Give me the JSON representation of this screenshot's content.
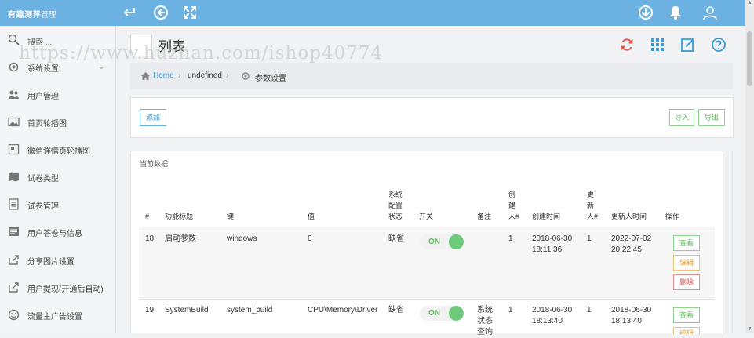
{
  "topbar": {
    "brand": "有趣测评",
    "brand_sub": "管理",
    "icons": [
      "back-icon",
      "circle-left-icon",
      "fullscreen-icon",
      "download-icon",
      "bell-icon",
      "user-icon"
    ]
  },
  "sidebar": {
    "search_placeholder": "搜索 ...",
    "items": [
      {
        "label": "系统设置",
        "icon": "gear-icon",
        "expandable": true
      },
      {
        "label": "用户管理",
        "icon": "users-icon"
      },
      {
        "label": "首页轮播图",
        "icon": "image-icon"
      },
      {
        "label": "微信详情页轮播图",
        "icon": "picture-icon"
      },
      {
        "label": "试卷类型",
        "icon": "map-icon"
      },
      {
        "label": "试卷管理",
        "icon": "file-icon"
      },
      {
        "label": "用户答卷与信息",
        "icon": "newspaper-icon"
      },
      {
        "label": "分享图片设置",
        "icon": "share-icon"
      },
      {
        "label": "用户提现(开通后自动)",
        "icon": "share-out-icon"
      },
      {
        "label": "流量主广告设置",
        "icon": "smile-icon"
      }
    ]
  },
  "watermark": "https://www.huzhan.com/ishop40774",
  "page": {
    "title": "列表",
    "tools": [
      "refresh-icon",
      "grid-icon",
      "edit-icon",
      "help-icon"
    ]
  },
  "breadcrumb": {
    "home": "Home",
    "middle": "undefined",
    "current": "参数设置",
    "sep": "›"
  },
  "actions": {
    "add": "添加",
    "import": "导入",
    "export": "导出"
  },
  "table": {
    "section_label": "当前数据",
    "headers": {
      "id": "#",
      "title": "功能标题",
      "key": "键",
      "value": "值",
      "status": [
        "系统",
        "配置",
        "状态"
      ],
      "switch": "开关",
      "remark": "备注",
      "creator": [
        "创",
        "建",
        "人#"
      ],
      "created": "创建时间",
      "updater": [
        "更",
        "新",
        "人#"
      ],
      "updated": "更新人时间",
      "ops": "操作"
    },
    "rows": [
      {
        "id": "18",
        "title": "启动参数",
        "key": "windows",
        "value": "0",
        "status": "缺省",
        "switch": "ON",
        "remark": [
          "",
          "",
          ""
        ],
        "creator": "1",
        "created": [
          "2018-06-30",
          "18:11:36"
        ],
        "updater": "1",
        "updated": [
          "2022-07-02",
          "20:22:45"
        ],
        "ops": [
          "查看",
          "编辑",
          "删除"
        ]
      },
      {
        "id": "19",
        "title": "SystemBuild",
        "key": "system_build",
        "value": "CPU\\Memory\\Driver",
        "status": "缺省",
        "switch": "ON",
        "remark": [
          "系统",
          "状态",
          "查询"
        ],
        "creator": "1",
        "created": [
          "2018-06-30",
          "18:13:40"
        ],
        "updater": "1",
        "updated": [
          "2018-06-30",
          "18:13:40"
        ],
        "ops": [
          "查看",
          "编辑"
        ]
      }
    ]
  },
  "colors": {
    "topbar": "#6bb2e3",
    "toggle_on": "#6fcb7c",
    "success": "#5cb85c",
    "warning": "#e8a23a",
    "danger": "#d9534f"
  }
}
